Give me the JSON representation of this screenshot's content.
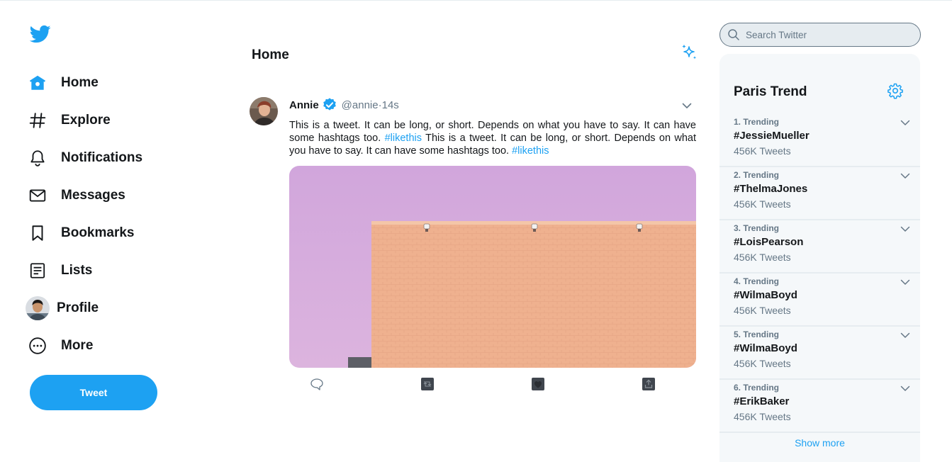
{
  "colors": {
    "accent": "#1da1f2",
    "text": "#14171a",
    "muted": "#657786",
    "panel": "#f5f8fa"
  },
  "nav": {
    "logo_icon": "bird-icon",
    "items": [
      {
        "label": "Home",
        "icon": "home-icon"
      },
      {
        "label": "Explore",
        "icon": "hashtag-icon"
      },
      {
        "label": "Notifications",
        "icon": "bell-icon"
      },
      {
        "label": "Messages",
        "icon": "envelope-icon"
      },
      {
        "label": "Bookmarks",
        "icon": "bookmark-icon"
      },
      {
        "label": "Lists",
        "icon": "list-icon"
      },
      {
        "label": "Profile",
        "icon": "avatar"
      },
      {
        "label": "More",
        "icon": "more-circle-icon"
      }
    ],
    "tweet_button": "Tweet"
  },
  "main": {
    "title": "Home",
    "tweet": {
      "name": "Annie",
      "handle": "@annie",
      "separator": " · ",
      "time": "14s",
      "text_1": "This is a tweet. It can be long, or short. Depends on what you have to say. It can have some hashtags too. ",
      "hashtag_1": "#likethis",
      "text_2": " This is a tweet. It can be long, or short. Depends on what you have to say. It can have some hashtags too. ",
      "hashtag_2": "#likethis",
      "actions": [
        "reply-icon",
        "retweet-icon",
        "like-icon",
        "share-icon"
      ]
    }
  },
  "search": {
    "placeholder": "Search Twitter"
  },
  "trends": {
    "title": "Paris Trend",
    "items": [
      {
        "rank": "1. Trending",
        "tag": "#JessieMueller",
        "count": "456K Tweets"
      },
      {
        "rank": "2. Trending",
        "tag": "#ThelmaJones",
        "count": "456K Tweets"
      },
      {
        "rank": "3. Trending",
        "tag": "#LoisPearson",
        "count": "456K Tweets"
      },
      {
        "rank": "4. Trending",
        "tag": "#WilmaBoyd",
        "count": "456K Tweets"
      },
      {
        "rank": "5. Trending",
        "tag": "#WilmaBoyd",
        "count": "456K Tweets"
      },
      {
        "rank": "6. Trending",
        "tag": "#ErikBaker",
        "count": "456K Tweets"
      }
    ],
    "show_more": "Show more"
  }
}
